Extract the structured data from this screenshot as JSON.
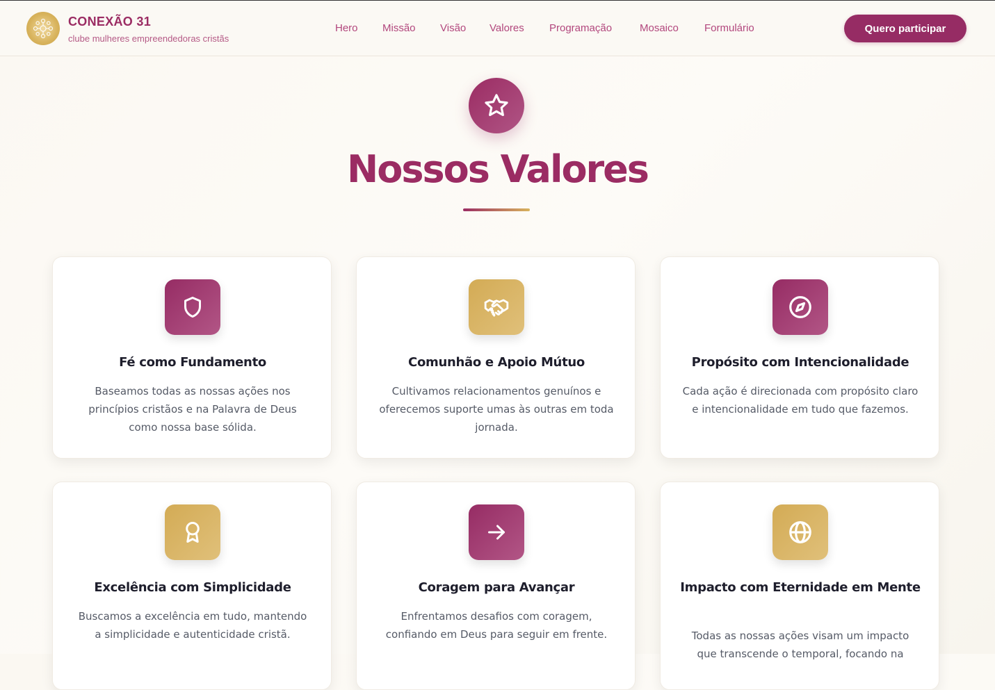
{
  "brand": {
    "name": "CONEXÃO 31",
    "tagline": "clube mulheres empreendedoras cristãs"
  },
  "nav": {
    "items": [
      "Hero",
      "Missão",
      "Visão",
      "Valores",
      "Programação",
      "Mosaico",
      "Formulário"
    ],
    "cta_label": "Quero participar"
  },
  "section": {
    "icon": "star-icon",
    "title": "Nossos Valores"
  },
  "values": [
    {
      "icon": "shield-icon",
      "color": "plum",
      "title": "Fé como Fundamento",
      "text": "Baseamos todas as nossas ações nos princípios cristãos e na Palavra de Deus como nossa base sólida."
    },
    {
      "icon": "handshake-icon",
      "color": "gold",
      "title": "Comunhão e Apoio Mútuo",
      "text": "Cultivamos relacionamentos genuínos e oferecemos suporte umas às outras em toda jornada."
    },
    {
      "icon": "compass-icon",
      "color": "plum",
      "title": "Propósito com Intencionalidade",
      "text": "Cada ação é direcionada com propósito claro e intencionalidade em tudo que fazemos."
    },
    {
      "icon": "award-icon",
      "color": "gold",
      "title": "Excelência com Simplicidade",
      "text": "Buscamos a excelência em tudo, mantendo a simplicidade e autenticidade cristã."
    },
    {
      "icon": "arrow-right-icon",
      "color": "plum",
      "title": "Coragem para Avançar",
      "text": "Enfrentamos desafios com coragem, confiando em Deus para seguir em frente."
    },
    {
      "icon": "globe-icon",
      "color": "gold",
      "title": "Impacto com Eternidade em Mente",
      "text": "Todas as nossas ações visam um impacto que transcende o temporal, focando na"
    }
  ],
  "colors": {
    "plum": "#962c64",
    "gold": "#d3ab55",
    "background": "#fbf8f2"
  }
}
